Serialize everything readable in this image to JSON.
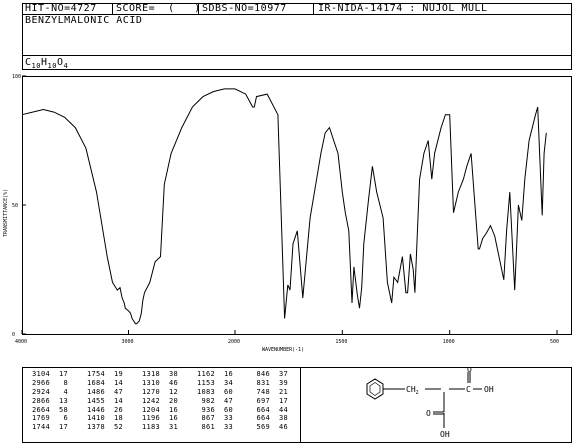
{
  "header": {
    "hit_no": "HIT-NO=4727",
    "score": "SCORE=  (   )",
    "sdbs_no": "SDBS-NO=10977",
    "ir_info": "IR-NIDA-14174 : NUJOL MULL",
    "compound_name": "BENZYLMALONIC ACID",
    "formula": {
      "c": "C",
      "c_n": "10",
      "h": "H",
      "h_n": "10",
      "o": "O",
      "o_n": "4"
    }
  },
  "chart_data": {
    "type": "line",
    "xlabel": "WAVENUMBER(-1)",
    "ylabel": "TRANSMITTANCE(%)",
    "y_ticks": [
      "100",
      "50",
      "0"
    ],
    "x_ticks": [
      "4000",
      "3000",
      "2000",
      "1500",
      "1000",
      "500"
    ],
    "x_axis": "wavenumber, reversed, scale change at 2000",
    "ylim": [
      0,
      100
    ],
    "x": [
      4000,
      3900,
      3800,
      3700,
      3600,
      3500,
      3400,
      3300,
      3200,
      3150,
      3104,
      3080,
      3060,
      3040,
      3030,
      3000,
      2980,
      2966,
      2950,
      2935,
      2924,
      2900,
      2880,
      2866,
      2850,
      2800,
      2750,
      2700,
      2664,
      2600,
      2500,
      2400,
      2300,
      2200,
      2100,
      2000,
      1950,
      1918,
      1910,
      1900,
      1850,
      1800,
      1769,
      1754,
      1744,
      1730,
      1710,
      1684,
      1650,
      1620,
      1600,
      1580,
      1560,
      1540,
      1520,
      1500,
      1486,
      1470,
      1455,
      1446,
      1430,
      1420,
      1410,
      1400,
      1378,
      1360,
      1340,
      1310,
      1290,
      1270,
      1260,
      1242,
      1220,
      1204,
      1196,
      1183,
      1170,
      1162,
      1153,
      1140,
      1120,
      1100,
      1083,
      1070,
      1040,
      1020,
      1000,
      982,
      960,
      936,
      920,
      900,
      867,
      861,
      846,
      830,
      810,
      790,
      770,
      748,
      735,
      720,
      697,
      690,
      680,
      664,
      650,
      630,
      600,
      590,
      569,
      560,
      550
    ],
    "y": [
      85,
      86,
      87,
      86,
      84,
      80,
      72,
      55,
      30,
      20,
      17,
      18,
      14,
      12,
      10,
      9,
      8,
      6,
      5,
      4,
      4,
      5,
      8,
      13,
      16,
      20,
      28,
      30,
      58,
      70,
      80,
      88,
      92,
      94,
      95,
      95,
      93,
      88,
      88,
      92,
      93,
      85,
      6,
      19,
      17,
      35,
      40,
      14,
      45,
      60,
      70,
      78,
      80,
      75,
      70,
      55,
      47,
      40,
      12,
      26,
      15,
      10,
      18,
      35,
      52,
      65,
      55,
      45,
      20,
      12,
      22,
      20,
      30,
      16,
      16,
      31,
      25,
      16,
      34,
      60,
      70,
      75,
      60,
      70,
      80,
      85,
      85,
      47,
      55,
      60,
      65,
      70,
      33,
      33,
      37,
      39,
      42,
      38,
      30,
      21,
      40,
      55,
      17,
      30,
      50,
      44,
      60,
      75,
      85,
      88,
      46,
      70,
      78
    ]
  },
  "peak_table": [
    [
      [
        "3104",
        "17"
      ],
      [
        "2966",
        "8"
      ],
      [
        "2924",
        "4"
      ],
      [
        "2866",
        "13"
      ],
      [
        "2664",
        "58"
      ],
      [
        "1769",
        "6"
      ],
      [
        "1744",
        "17"
      ]
    ],
    [
      [
        "1754",
        "19"
      ],
      [
        "1684",
        "14"
      ],
      [
        "1486",
        "47"
      ],
      [
        "1455",
        "14"
      ],
      [
        "1446",
        "26"
      ],
      [
        "1410",
        "18"
      ],
      [
        "1378",
        "52"
      ]
    ],
    [
      [
        "1318",
        "38"
      ],
      [
        "1310",
        "46"
      ],
      [
        "1270",
        "12"
      ],
      [
        "1242",
        "20"
      ],
      [
        "1204",
        "16"
      ],
      [
        "1196",
        "16"
      ],
      [
        "1183",
        "31"
      ]
    ],
    [
      [
        "1162",
        "16"
      ],
      [
        "1153",
        "34"
      ],
      [
        "1083",
        "60"
      ],
      [
        "982",
        "47"
      ],
      [
        "936",
        "60"
      ],
      [
        "867",
        "33"
      ],
      [
        "861",
        "33"
      ]
    ],
    [
      [
        "846",
        "37"
      ],
      [
        "831",
        "39"
      ],
      [
        "748",
        "21"
      ],
      [
        "697",
        "17"
      ],
      [
        "664",
        "44"
      ],
      [
        "664",
        "38"
      ],
      [
        "569",
        "46"
      ]
    ]
  ],
  "structure": {
    "ch2": "CH",
    "ch2_sub": "2",
    "oh_top": "OH",
    "oh_bottom": "OH",
    "o_left": "O",
    "o_top": "O"
  }
}
